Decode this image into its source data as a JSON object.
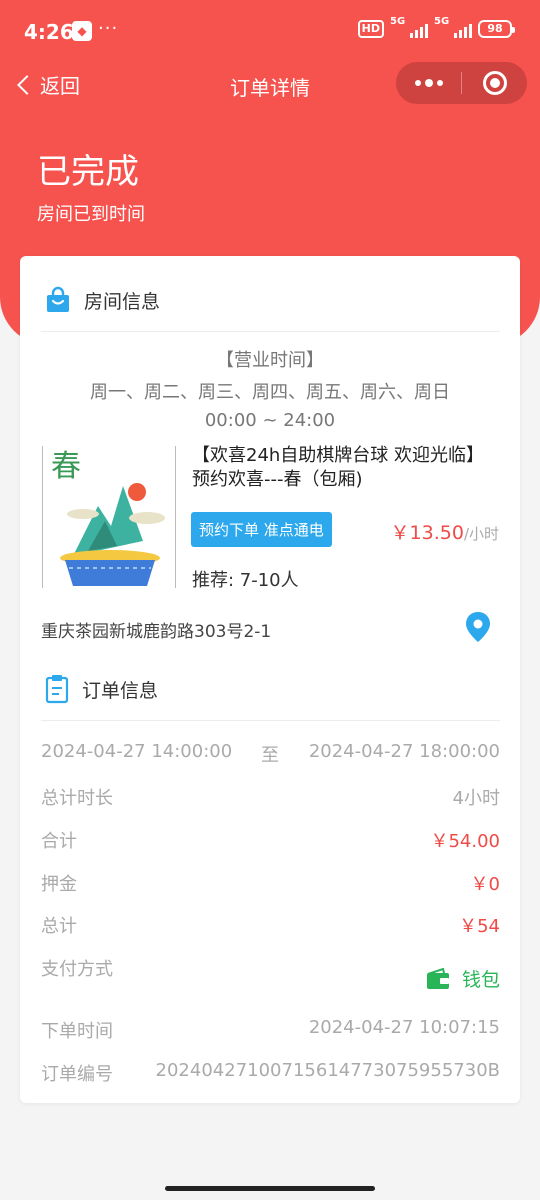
{
  "status_bar": {
    "time": "4:26",
    "hd": "HD",
    "net1": "5G",
    "net2": "5G",
    "battery": "98"
  },
  "nav": {
    "back_label": "返回",
    "title": "订单详情"
  },
  "order_status": {
    "title": "已完成",
    "subtitle": "房间已到时间"
  },
  "room_section": {
    "header": "房间信息",
    "hours_label": "【营业时间】",
    "days": "周一、周二、周三、周四、周五、周六、周日",
    "time_range": "00:00 ~ 24:00",
    "thumb_text": "春",
    "title": "【欢喜24h自助棋牌台球 欢迎光临】预约欢喜---春（包厢)",
    "tag": "预约下单 准点通电",
    "price": "￥13.50",
    "price_unit": "/小时",
    "recommend": "推荐: 7-10人",
    "address": "重庆茶园新城鹿韵路303号2-1"
  },
  "order_section": {
    "header": "订单信息",
    "start_time": "2024-04-27 14:00:00",
    "to_label": "至",
    "end_time": "2024-04-27 18:00:00",
    "duration_label": "总计时长",
    "duration_value": "4小时",
    "subtotal_label": "合计",
    "subtotal_value": "￥54.00",
    "deposit_label": "押金",
    "deposit_value": "￥0",
    "total_label": "总计",
    "total_value": "￥54",
    "payment_label": "支付方式",
    "payment_value": "钱包",
    "order_time_label": "下单时间",
    "order_time_value": "2024-04-27 10:07:15",
    "order_no_label": "订单编号",
    "order_no_value": "20240427100715614773075955730B"
  },
  "colors": {
    "primary": "#f6534f",
    "price": "#ef4b47",
    "tag": "#2da8ec",
    "wallet": "#29b458"
  }
}
